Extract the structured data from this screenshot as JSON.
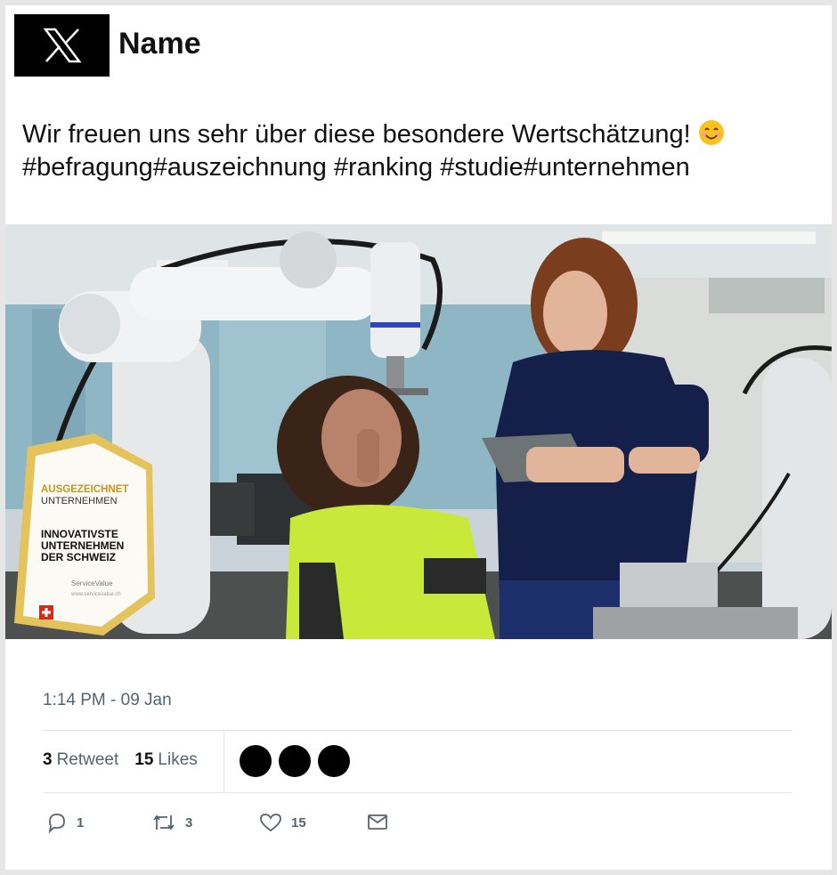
{
  "header": {
    "logo_icon": "x-logo-icon",
    "name": "Name"
  },
  "tweet": {
    "line1": "Wir freuen uns sehr über diese besondere Wertschätzung!",
    "emoji": "smiling-face-emoji",
    "line2": "#befragung#auszeichnung #ranking #studie#unternehmen"
  },
  "media": {
    "badge": {
      "line1": "AUSGEZEICHNET",
      "line2": "UNTERNEHMEN",
      "title1": "INNOVATIVSTE",
      "title2": "UNTERNEHMEN",
      "title3": "DER SCHWEIZ",
      "brand": "ServiceValue",
      "url": "www.servicevalue.ch",
      "flag_icon": "swiss-flag-icon"
    }
  },
  "meta": {
    "timestamp": "1:14 PM - 09 Jan"
  },
  "stats": {
    "retweet_count": "3",
    "retweet_label": "Retweet",
    "likes_count": "15",
    "likes_label": "Likes"
  },
  "actions": {
    "reply_count": "1",
    "retweet_count": "3",
    "like_count": "15"
  },
  "colors": {
    "muted": "#536471",
    "badge_gold": "#d6a72b",
    "shirt_green": "#c9e83a",
    "shirt_navy": "#15204a"
  }
}
